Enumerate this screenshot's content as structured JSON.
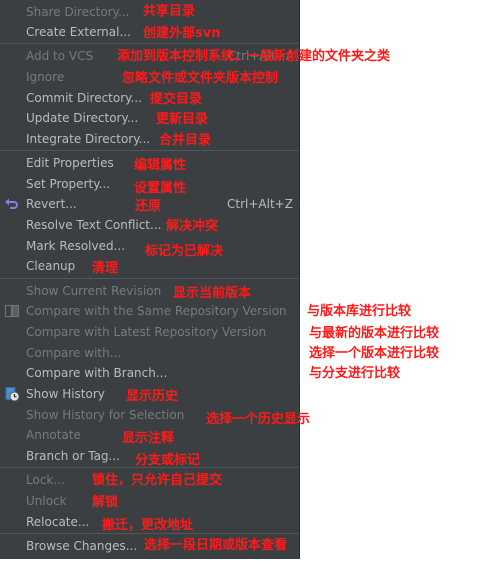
{
  "menu": {
    "share_directory": "Share Directory...",
    "create_external": "Create External...",
    "add_to_vcs": "Add to VCS",
    "add_to_vcs_shortcut": "Ctrl+Alt+A",
    "ignore": "Ignore",
    "commit_directory": "Commit Directory...",
    "update_directory": "Update Directory...",
    "integrate_directory": "Integrate Directory...",
    "edit_properties": "Edit Properties",
    "set_property": "Set Property...",
    "revert": "Revert...",
    "revert_shortcut": "Ctrl+Alt+Z",
    "resolve_text_conflict": "Resolve Text Conflict...",
    "mark_resolved": "Mark Resolved...",
    "cleanup": "Cleanup",
    "show_current_revision": "Show Current Revision",
    "compare_same_repo": "Compare with the Same Repository Version",
    "compare_latest_repo": "Compare with Latest Repository Version",
    "compare_with": "Compare with...",
    "compare_with_branch": "Compare with Branch...",
    "show_history": "Show History",
    "show_history_selection": "Show History for Selection",
    "annotate": "Annotate",
    "branch_or_tag": "Branch or Tag...",
    "lock": "Lock...",
    "unlock": "Unlock",
    "relocate": "Relocate...",
    "browse_changes": "Browse Changes..."
  },
  "annotations": {
    "share_directory": "共享目录",
    "create_external": "创建外部svn",
    "add_to_vcs": "添加到版本控制系统，一般新创建的文件夹之类",
    "ignore": "忽略文件或文件夹版本控制",
    "commit_directory": "提交目录",
    "update_directory": "更新目录",
    "integrate_directory": "合并目录",
    "edit_properties": "编辑属性",
    "set_property": "设置属性",
    "revert": "还原",
    "resolve_text_conflict": "解决冲突",
    "mark_resolved": "标记为已解决",
    "cleanup": "清理",
    "show_current_revision": "显示当前版本",
    "compare_same_repo": "与版本库进行比较",
    "compare_latest_repo": "与最新的版本进行比较",
    "compare_with": "选择一个版本进行比较",
    "compare_with_branch": "与分支进行比较",
    "show_history": "显示历史",
    "show_history_selection": "选择一个历史显示",
    "annotate": "显示注释",
    "branch_or_tag": "分支或标记",
    "lock": "锁住，只允许自己提交",
    "unlock": "解锁",
    "relocate": "搬迁，更改地址",
    "browse_changes": "选择一段日期或版本查看"
  },
  "icons": {
    "revert": "revert-arrow-icon",
    "compare_same_repo": "compare-icon",
    "show_history": "history-icon"
  },
  "colors": {
    "menu_bg": "#3c3f41",
    "enabled_text": "#bbbbbb",
    "disabled_text": "#777a7c",
    "annotation": "#ff1a1a"
  }
}
